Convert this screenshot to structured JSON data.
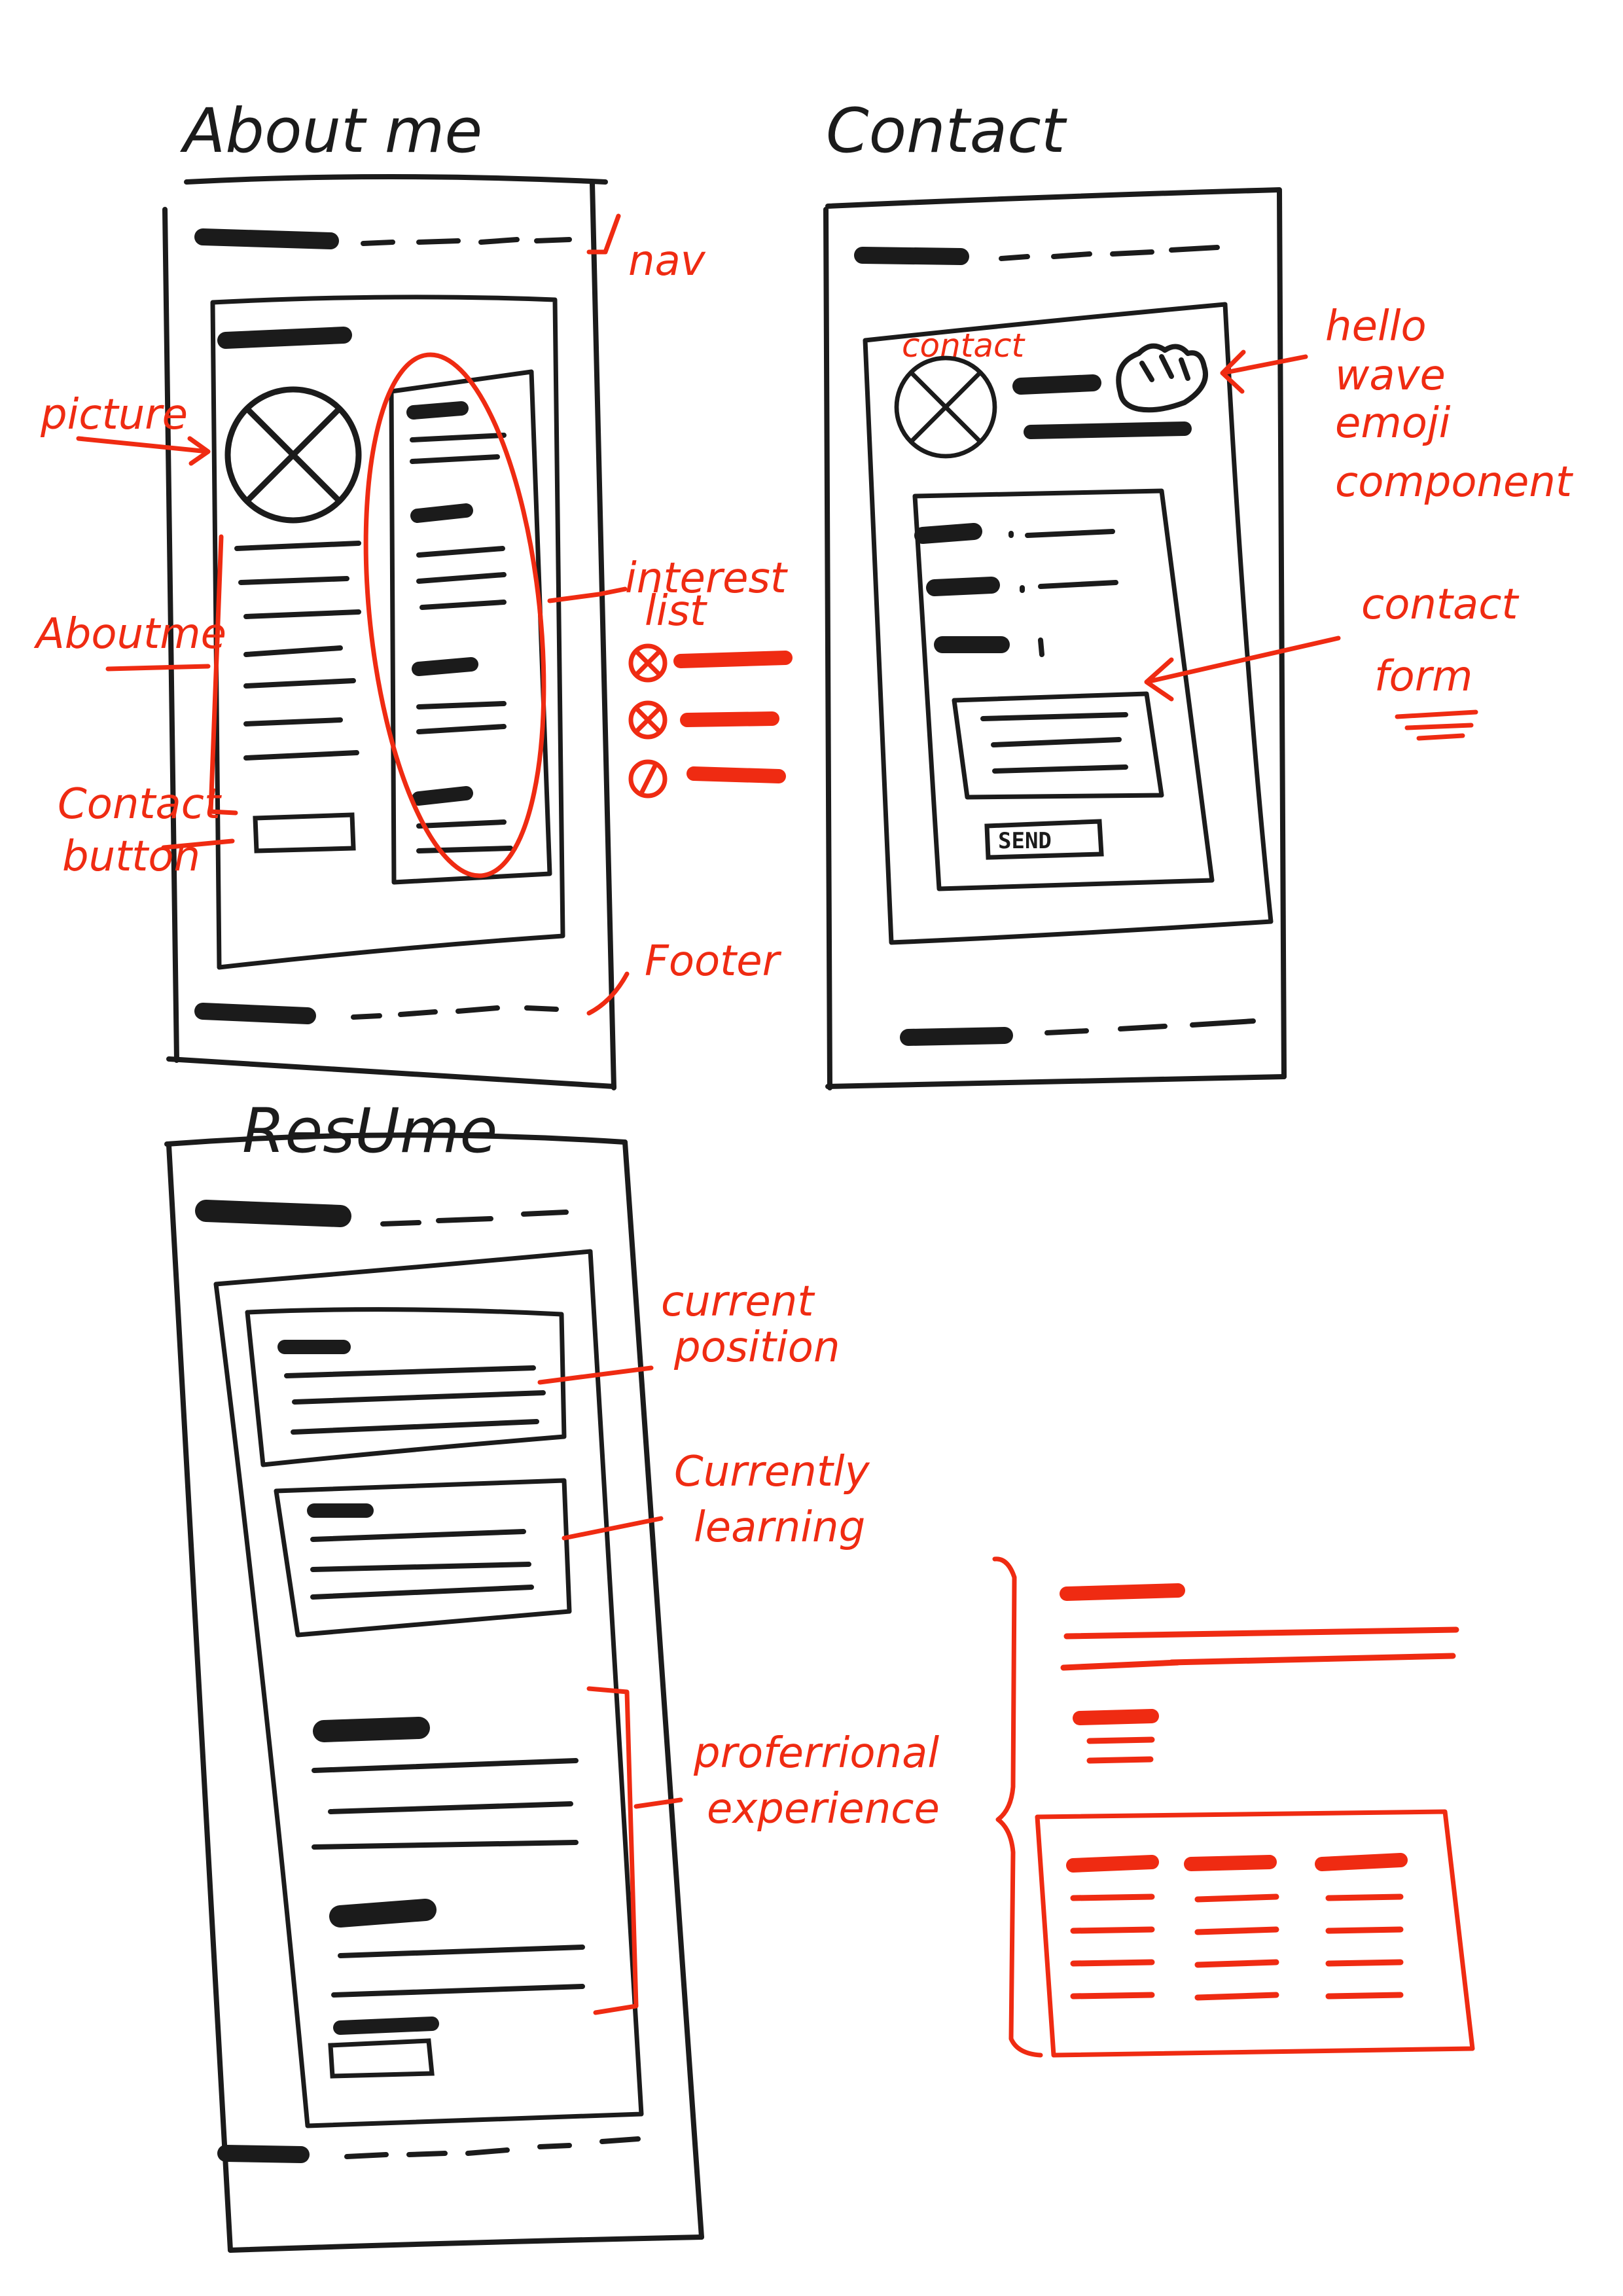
{
  "colors": {
    "ink": "#1b1b1b",
    "accent": "#ef2b12",
    "paper": "#ffffff"
  },
  "pages": {
    "about": {
      "title": "About me",
      "annotations": {
        "nav": "nav",
        "picture": "picture",
        "about_me": "Aboutme",
        "contact_button_l1": "Contact",
        "contact_button_l2": "button",
        "interest_list_l1": "interest",
        "interest_list_l2": "list",
        "footer": "Footer"
      }
    },
    "contact": {
      "title": "Contact",
      "card_label": "contact",
      "send_label": "SEND",
      "annotations": {
        "hello_l1": "hello",
        "hello_l2": "wave",
        "hello_l3": "emoji",
        "hello_l4": "component",
        "form_l1": "contact",
        "form_l2": "form"
      }
    },
    "resume": {
      "title": "ResUme",
      "annotations": {
        "current_l1": "current",
        "current_l2": "position",
        "learning_l1": "Currently",
        "learning_l2": "learning",
        "experience_l1": "proferrional",
        "experience_l2": "experience"
      }
    }
  }
}
